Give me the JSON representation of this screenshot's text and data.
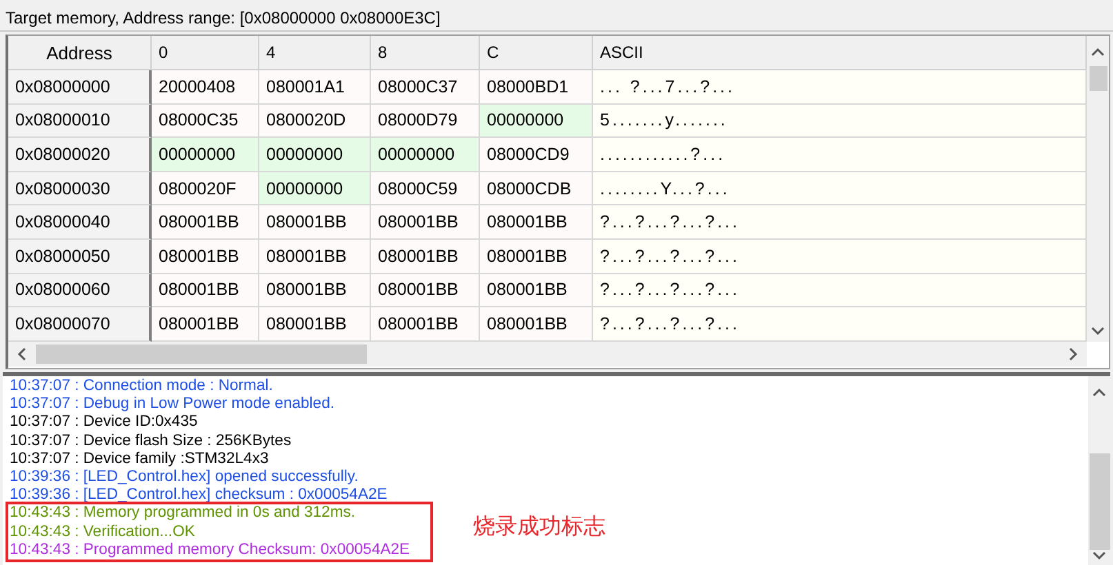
{
  "header": {
    "title": "Target memory, Address range: [0x08000000 0x08000E3C]"
  },
  "memory_table": {
    "columns": [
      "Address",
      "0",
      "4",
      "8",
      "C",
      "ASCII"
    ],
    "rows": [
      {
        "address": "0x08000000",
        "words": [
          {
            "value": "20000408",
            "highlighted": false
          },
          {
            "value": "080001A1",
            "highlighted": false
          },
          {
            "value": "08000C37",
            "highlighted": false
          },
          {
            "value": "08000BD1",
            "highlighted": false
          }
        ],
        "ascii": "...  ?...7...?..."
      },
      {
        "address": "0x08000010",
        "words": [
          {
            "value": "08000C35",
            "highlighted": false
          },
          {
            "value": "0800020D",
            "highlighted": false
          },
          {
            "value": "08000D79",
            "highlighted": false
          },
          {
            "value": "00000000",
            "highlighted": true
          }
        ],
        "ascii": "5.......y......."
      },
      {
        "address": "0x08000020",
        "words": [
          {
            "value": "00000000",
            "highlighted": true
          },
          {
            "value": "00000000",
            "highlighted": true
          },
          {
            "value": "00000000",
            "highlighted": true
          },
          {
            "value": "08000CD9",
            "highlighted": false
          }
        ],
        "ascii": "............?..."
      },
      {
        "address": "0x08000030",
        "words": [
          {
            "value": "0800020F",
            "highlighted": false
          },
          {
            "value": "00000000",
            "highlighted": true
          },
          {
            "value": "08000C59",
            "highlighted": false
          },
          {
            "value": "08000CDB",
            "highlighted": false
          }
        ],
        "ascii": "........Y...?..."
      },
      {
        "address": "0x08000040",
        "words": [
          {
            "value": "080001BB",
            "highlighted": false
          },
          {
            "value": "080001BB",
            "highlighted": false
          },
          {
            "value": "080001BB",
            "highlighted": false
          },
          {
            "value": "080001BB",
            "highlighted": false
          }
        ],
        "ascii": "?...?...?...?..."
      },
      {
        "address": "0x08000050",
        "words": [
          {
            "value": "080001BB",
            "highlighted": false
          },
          {
            "value": "080001BB",
            "highlighted": false
          },
          {
            "value": "080001BB",
            "highlighted": false
          },
          {
            "value": "080001BB",
            "highlighted": false
          }
        ],
        "ascii": "?...?...?...?..."
      },
      {
        "address": "0x08000060",
        "words": [
          {
            "value": "080001BB",
            "highlighted": false
          },
          {
            "value": "080001BB",
            "highlighted": false
          },
          {
            "value": "080001BB",
            "highlighted": false
          },
          {
            "value": "080001BB",
            "highlighted": false
          }
        ],
        "ascii": "?...?...?...?..."
      },
      {
        "address": "0x08000070",
        "words": [
          {
            "value": "080001BB",
            "highlighted": false
          },
          {
            "value": "080001BB",
            "highlighted": false
          },
          {
            "value": "080001BB",
            "highlighted": false
          },
          {
            "value": "080001BB",
            "highlighted": false
          }
        ],
        "ascii": "?...?...?...?..."
      }
    ]
  },
  "log": {
    "lines": [
      {
        "text": "10:37:07 : Connection mode : Normal.",
        "color": "#1d4fe6",
        "marked": false
      },
      {
        "text": "10:37:07 : Debug in Low Power mode enabled.",
        "color": "#1d4fe6",
        "marked": false
      },
      {
        "text": "10:37:07 : Device ID:0x435",
        "color": "#000000",
        "marked": false
      },
      {
        "text": "10:37:07 : Device flash Size : 256KBytes",
        "color": "#000000",
        "marked": false
      },
      {
        "text": "10:37:07 : Device family :STM32L4x3",
        "color": "#000000",
        "marked": false
      },
      {
        "text": "10:39:36 : [LED_Control.hex] opened successfully.",
        "color": "#1d4fe6",
        "marked": false
      },
      {
        "text": "10:39:36 : [LED_Control.hex] checksum : 0x00054A2E",
        "color": "#1d4fe6",
        "marked": false
      },
      {
        "text": "10:43:43 : Memory programmed in 0s and 312ms.",
        "color": "#5f9400",
        "marked": true
      },
      {
        "text": "10:43:43 : Verification...OK",
        "color": "#5f9400",
        "marked": true
      },
      {
        "text": "10:43:43 : Programmed memory Checksum: 0x00054A2E",
        "color": "#b02ee0",
        "marked": true
      }
    ],
    "annotation": "烧录成功标志"
  }
}
